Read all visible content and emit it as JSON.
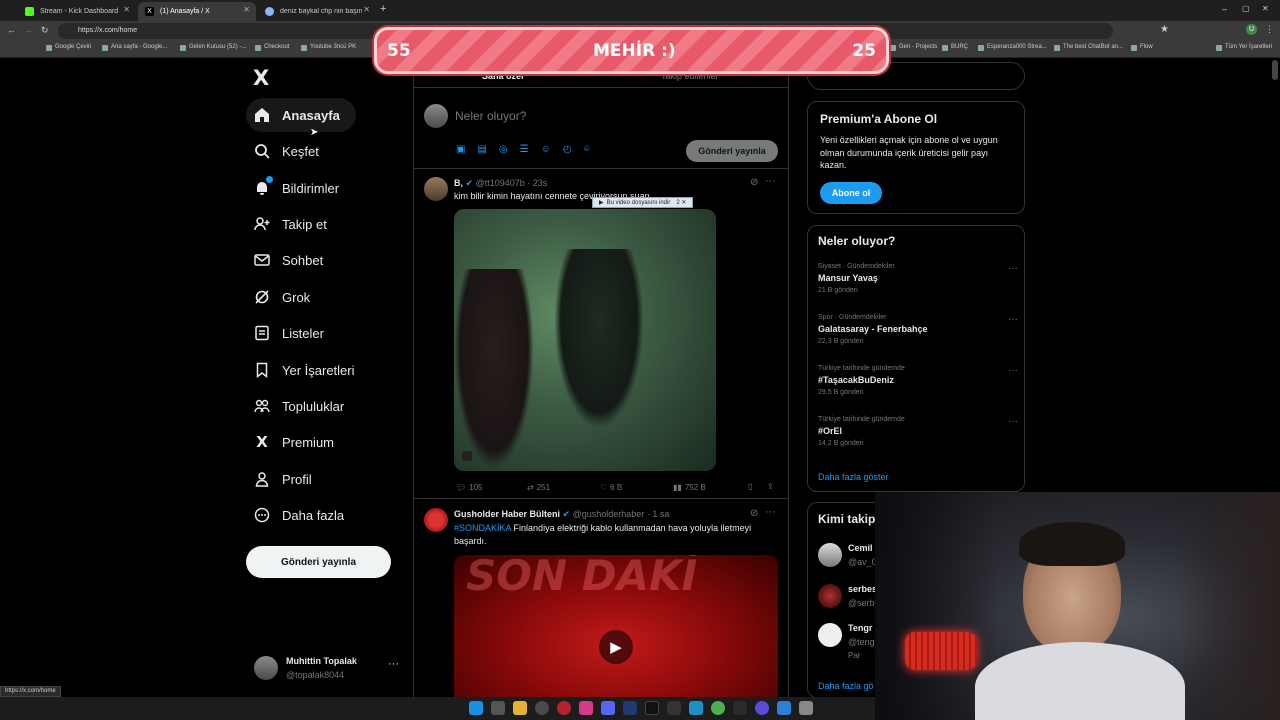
{
  "browser": {
    "tabs": [
      {
        "label": "Stream - Kick Dashboard",
        "color": "#53fc18"
      },
      {
        "label": "(1) Anasayfa / X",
        "color": "#ffffff"
      },
      {
        "label": "deniz baykal chp nin başında ki",
        "color": "#8ab4f8"
      }
    ],
    "url": "https://x.com/home",
    "bookmarks": [
      "Google Çeviri",
      "Ana sayfa - Google...",
      "Gelen Kutusu (52) -...",
      "Checkout",
      "Youtube 3ncü PK",
      "Gen - Projects",
      "BURÇ",
      "Esperanza000 Strea...",
      "The best ChatBot an...",
      "Flow",
      "Tüm Yer İşaretleri"
    ],
    "status_url": "https://x.com/home"
  },
  "overlay": {
    "left": "55",
    "title": "MEHİR :)",
    "right": "25"
  },
  "nav": {
    "logo": "X",
    "items": [
      {
        "label": "Anasayfa",
        "icon": "home-icon"
      },
      {
        "label": "Keşfet",
        "icon": "search-icon"
      },
      {
        "label": "Bildirimler",
        "icon": "bell-icon"
      },
      {
        "label": "Takip et",
        "icon": "add-user-icon"
      },
      {
        "label": "Sohbet",
        "icon": "mail-icon"
      },
      {
        "label": "Grok",
        "icon": "grok-icon"
      },
      {
        "label": "Listeler",
        "icon": "list-icon"
      },
      {
        "label": "Yer İşaretleri",
        "icon": "bookmark-icon"
      },
      {
        "label": "Topluluklar",
        "icon": "communities-icon"
      },
      {
        "label": "Premium",
        "icon": "x-icon"
      },
      {
        "label": "Profil",
        "icon": "person-icon"
      },
      {
        "label": "Daha fazla",
        "icon": "more-circle-icon"
      }
    ],
    "post_button": "Gönderi yayınla",
    "account": {
      "name": "Muhittin Topalak",
      "handle": "@topalak8044"
    }
  },
  "feed": {
    "tabs": [
      "Sana özel",
      "Takip edilenler"
    ],
    "composer_placeholder": "Neler oluyor?",
    "composer_button": "Gönderi yayınla",
    "tweets": [
      {
        "name": "B,",
        "handle": "@tt109407b",
        "time": "23s",
        "text": "kim bilir kimin hayatını cennete çeviriyorsun suan",
        "download_label": "Bu video dosyasını indir",
        "replies": "105",
        "retweets": "251",
        "likes": "6 B",
        "views": "752 B"
      },
      {
        "name": "Gusholder Haber Bülteni",
        "handle": "@gusholderhaber",
        "time": "1 sa",
        "hashtag": "#SONDAKİKA",
        "text": "Finlandiya elektriği kablo kullanmadan hava yoluyla iletmeyi başardı.",
        "image_text": "SON DAKİ"
      }
    ]
  },
  "right": {
    "premium": {
      "title": "Premium'a Abone Ol",
      "text": "Yeni özellikleri açmak için abone ol ve uygun olman durumunda içerik üreticisi gelir payı kazan.",
      "button": "Abone ol"
    },
    "trends": {
      "title": "Neler oluyor?",
      "items": [
        {
          "category": "Siyaset · Gündemdekiler",
          "name": "Mansur Yavaş",
          "count": "21 B gönderi"
        },
        {
          "category": "Spor · Gündemdekiler",
          "name": "Galatasaray - Fenerbahçe",
          "count": "22,3 B gönderi"
        },
        {
          "category": "Türkiye tarihinde gündemde",
          "name": "#TaşacakBuDeniz",
          "count": "29,5 B gönderi"
        },
        {
          "category": "Türkiye tarihinde gündemde",
          "name": "#OrEl",
          "count": "14,2 B gönderi"
        }
      ],
      "more": "Daha fazla göster"
    },
    "who_to_follow": {
      "title": "Kimi takip",
      "users": [
        {
          "name": "Cemil",
          "handle": "@av_0"
        },
        {
          "name": "serbes",
          "handle": "@serb"
        },
        {
          "name": "Tengr",
          "handle": "@teng",
          "extra": "Par"
        }
      ],
      "more": "Daha fazla gö"
    }
  },
  "colors": {
    "accent": "#1d9bf0",
    "overlay": "#e85a6a"
  }
}
